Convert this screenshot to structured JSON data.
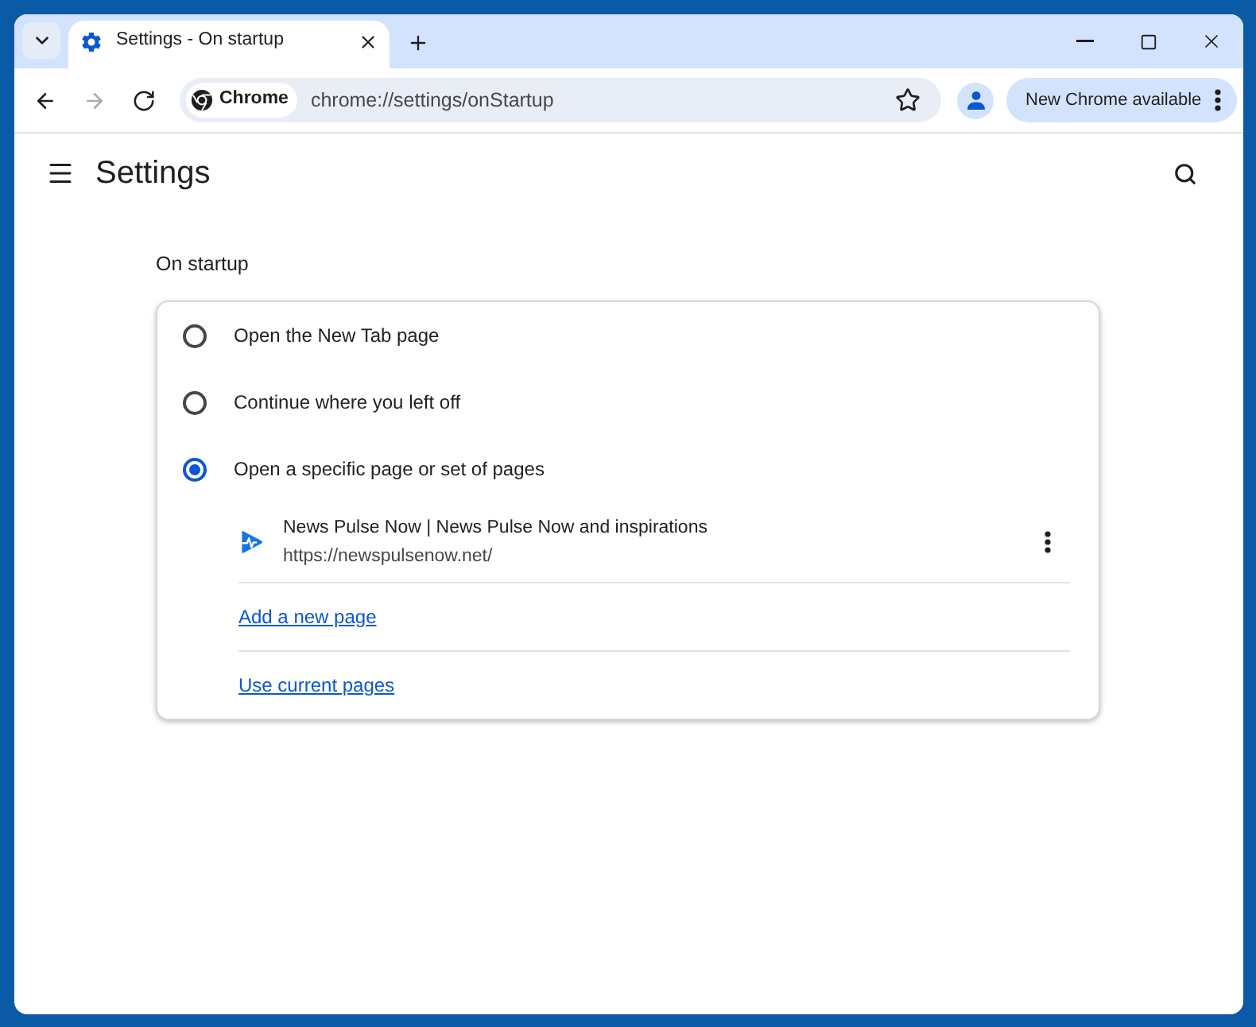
{
  "window": {
    "tab_title": "Settings - On startup"
  },
  "toolbar": {
    "nav_buttons": [
      {
        "kind": "back",
        "disabled": false
      },
      {
        "kind": "forward",
        "disabled": true
      },
      {
        "kind": "reload",
        "disabled": false
      }
    ],
    "site_chip": "Chrome",
    "url": "chrome://settings/onStartup",
    "update_button": "New Chrome available"
  },
  "settings_header": {
    "title": "Settings"
  },
  "on_startup": {
    "heading": "On startup",
    "options": [
      {
        "label": "Open the New Tab page",
        "selected": false
      },
      {
        "label": "Continue where you left off",
        "selected": false
      },
      {
        "label": "Open a specific page or set of pages",
        "selected": true
      }
    ],
    "pages": [
      {
        "title": "News Pulse Now | News Pulse Now and inspirations",
        "url": "https://newspulsenow.net/"
      }
    ],
    "links": [
      "Add a new page",
      "Use current pages"
    ]
  }
}
